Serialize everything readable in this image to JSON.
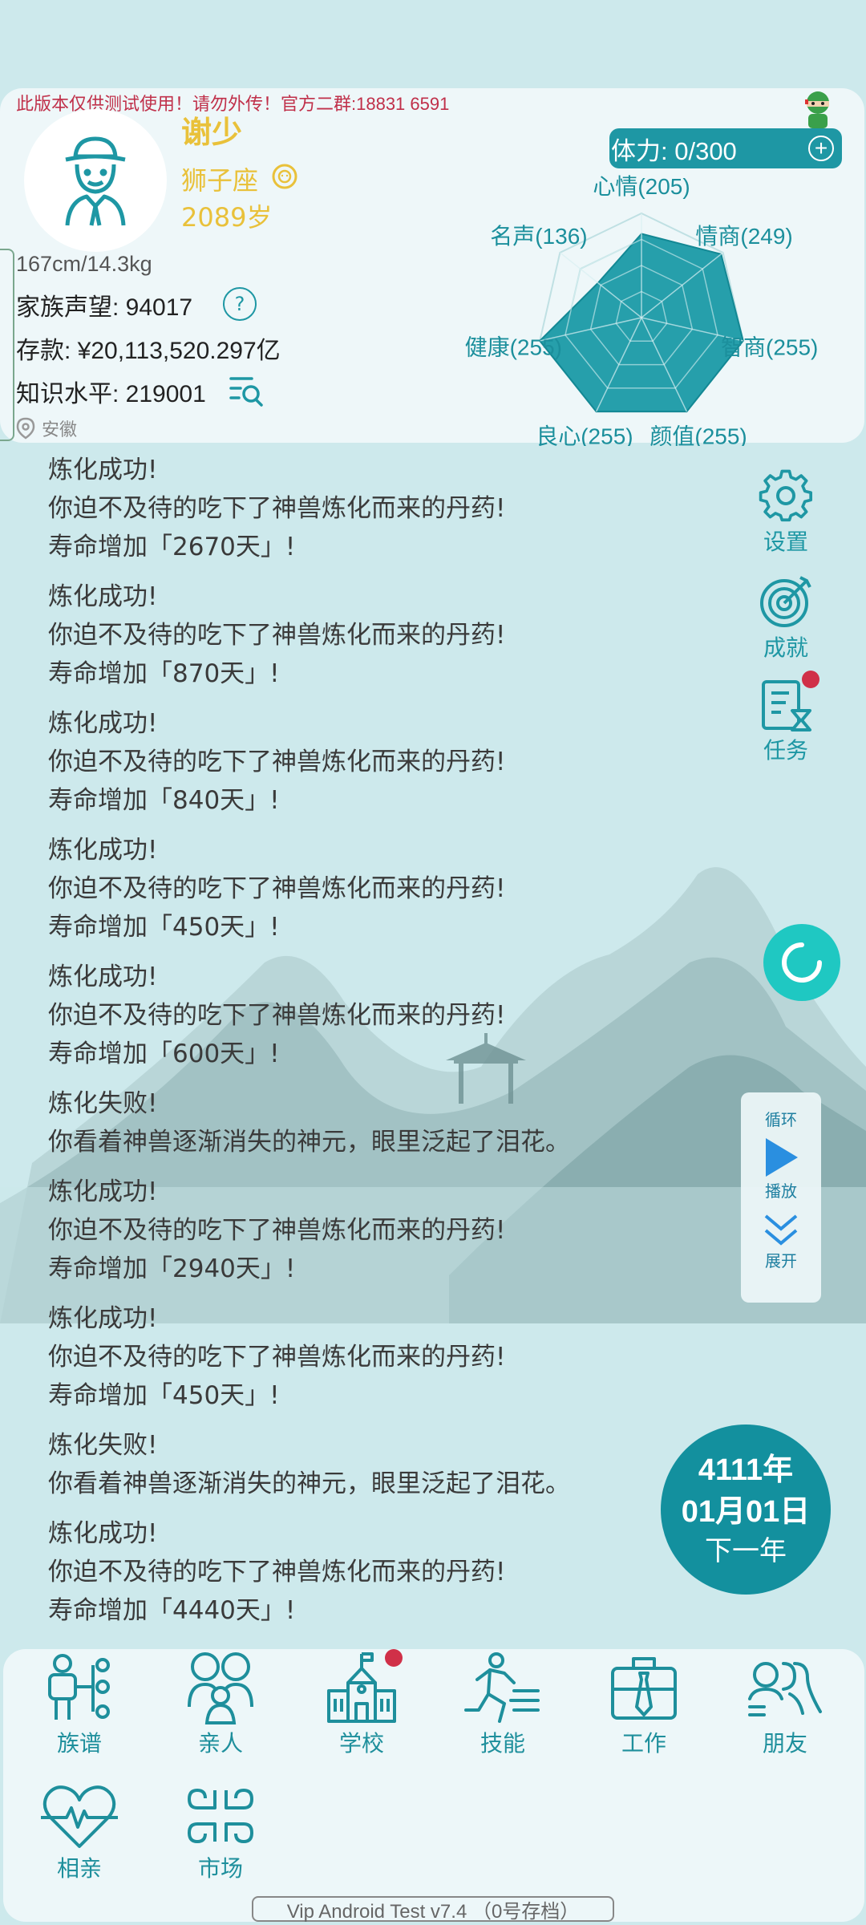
{
  "header": {
    "warning": "此版本仅供测试使用！请勿外传！官方二群:18831 6591",
    "name": "谢少",
    "zodiac": "狮子座",
    "age": "2089岁",
    "stamina": "体力: 0/300",
    "height_weight": "167cm/14.3kg",
    "family_prestige": "家族声望: 94017",
    "savings": "存款: ¥20,113,520.297亿",
    "knowledge": "知识水平: 219001",
    "location": "安徽"
  },
  "radar": {
    "labels": [
      "心情(205)",
      "情商(249)",
      "智商(255)",
      "颜值(255)",
      "良心(255)",
      "健康(255)",
      "名声(136)"
    ],
    "values": [
      205,
      249,
      255,
      255,
      255,
      255,
      136
    ],
    "max": 255,
    "color": "#1a9aa6"
  },
  "log": [
    [
      "炼化成功!",
      "你迫不及待的吃下了神兽炼化而来的丹药!",
      "寿命增加「2670天」!"
    ],
    [
      "炼化成功!",
      "你迫不及待的吃下了神兽炼化而来的丹药!",
      "寿命增加「870天」!"
    ],
    [
      "炼化成功!",
      "你迫不及待的吃下了神兽炼化而来的丹药!",
      "寿命增加「840天」!"
    ],
    [
      "炼化成功!",
      "你迫不及待的吃下了神兽炼化而来的丹药!",
      "寿命增加「450天」!"
    ],
    [
      "炼化成功!",
      "你迫不及待的吃下了神兽炼化而来的丹药!",
      "寿命增加「600天」!"
    ],
    [
      "炼化失败!",
      "你看着神兽逐渐消失的神元，眼里泛起了泪花。"
    ],
    [
      "炼化成功!",
      "你迫不及待的吃下了神兽炼化而来的丹药!",
      "寿命增加「2940天」!"
    ],
    [
      "炼化成功!",
      "你迫不及待的吃下了神兽炼化而来的丹药!",
      "寿命增加「450天」!"
    ],
    [
      "炼化失败!",
      "你看着神兽逐渐消失的神元，眼里泛起了泪花。"
    ],
    [
      "炼化成功!",
      "你迫不及待的吃下了神兽炼化而来的丹药!",
      "寿命增加「4440天」!"
    ]
  ],
  "side": {
    "settings": "设置",
    "achievements": "成就",
    "tasks": "任务"
  },
  "playback": {
    "loop": "循环",
    "play": "播放",
    "expand": "展开"
  },
  "year_button": {
    "year": "4111年",
    "date": "01月01日",
    "action": "下一年"
  },
  "nav": {
    "genealogy": "族谱",
    "relatives": "亲人",
    "school": "学校",
    "skills": "技能",
    "work": "工作",
    "friends": "朋友",
    "dating": "相亲",
    "market": "市场"
  },
  "version": "Vip Android Test v7.4 （0号存档）"
}
